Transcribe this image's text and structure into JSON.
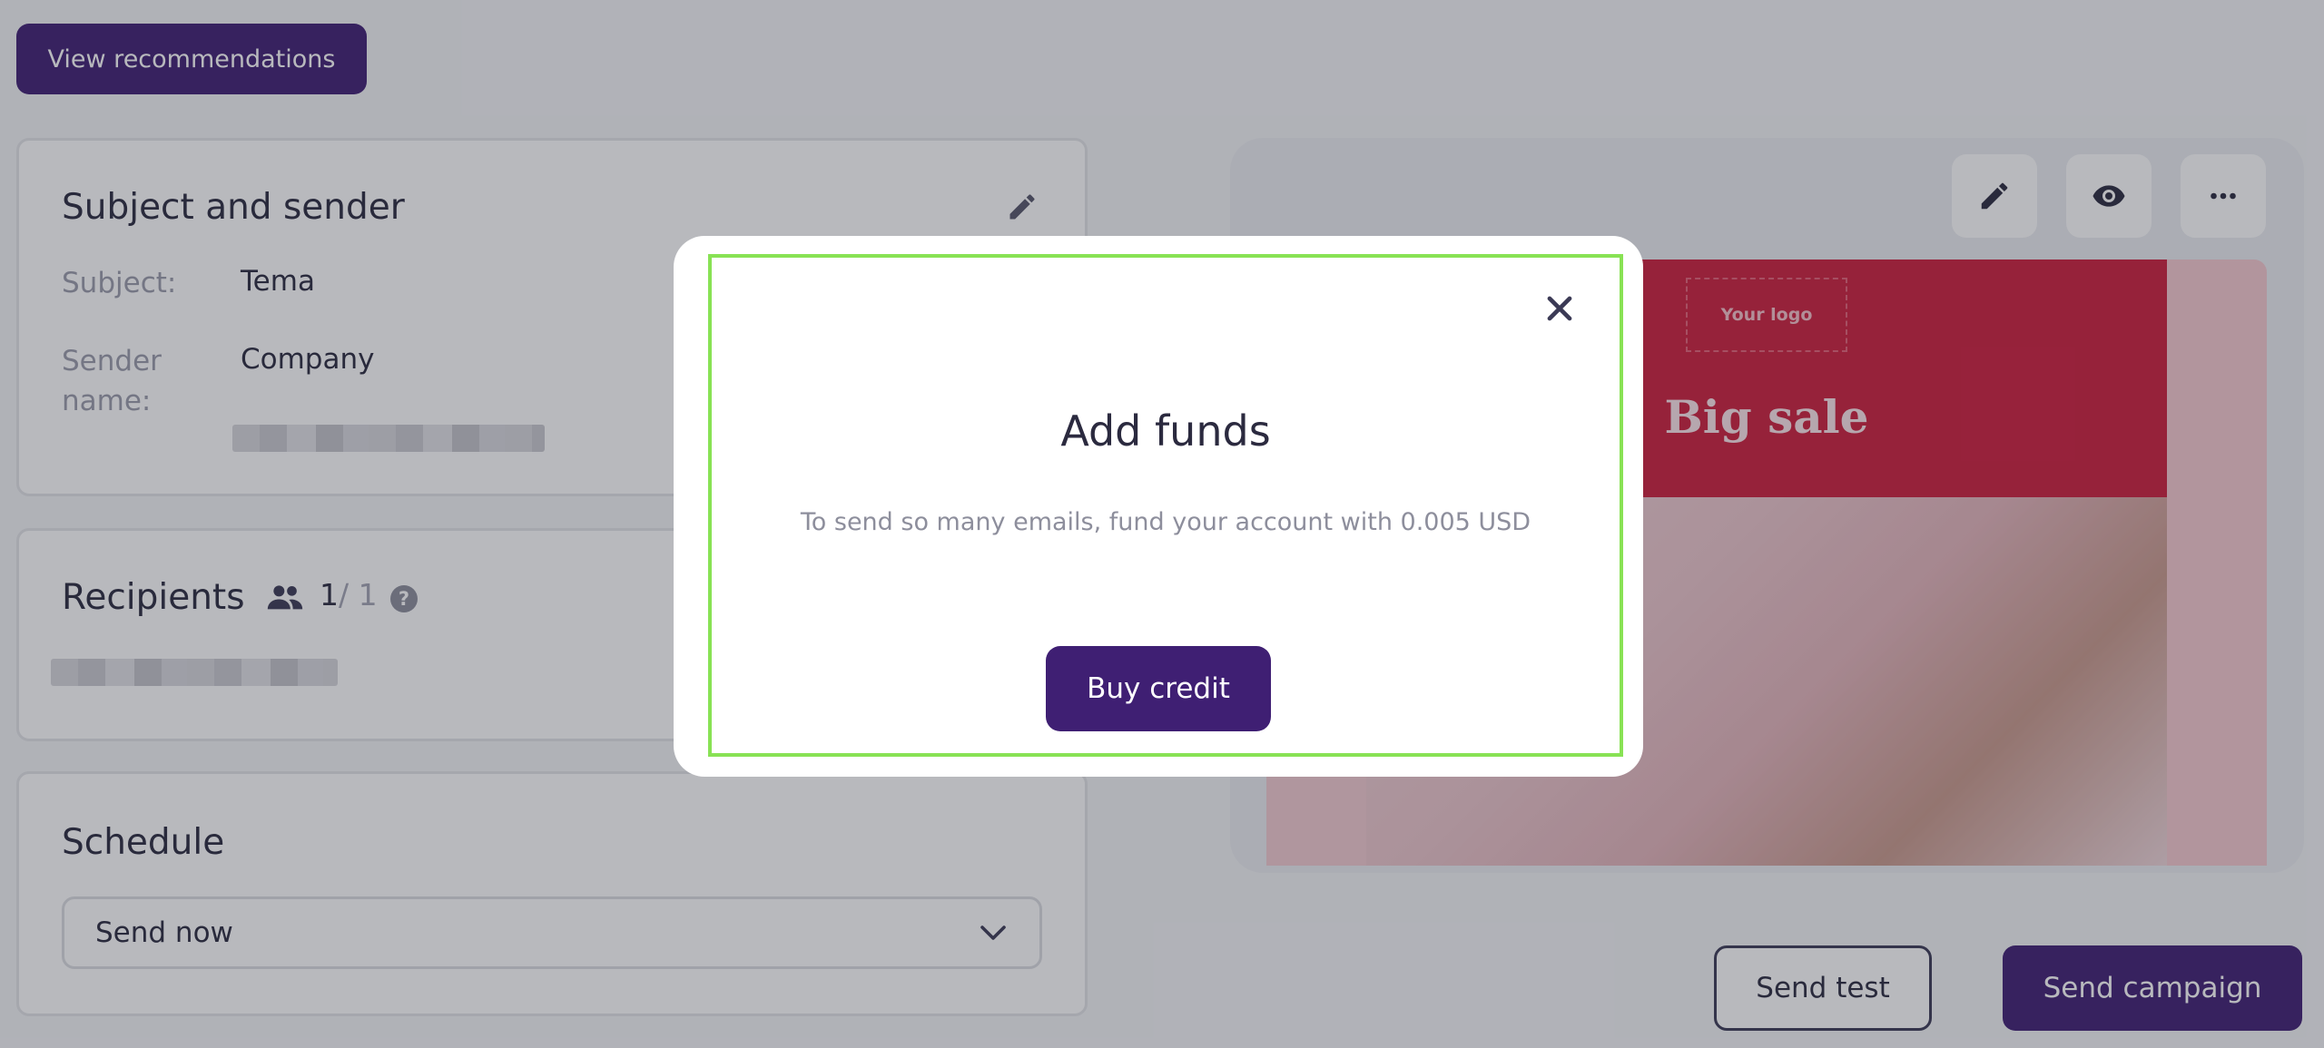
{
  "header": {
    "recommendations_label": "View recommendations"
  },
  "subject_card": {
    "title": "Subject and sender",
    "subject_label": "Subject:",
    "subject_value": "Tema",
    "sender_label_line1": "Sender",
    "sender_label_line2": "name:",
    "sender_value": "Company"
  },
  "recipients_card": {
    "title": "Recipients",
    "count_current": "1",
    "count_total": "/ 1",
    "help": "?"
  },
  "schedule_card": {
    "title": "Schedule",
    "selected_option": "Send now"
  },
  "preview": {
    "logo_text": "Your logo",
    "headline": "Big sale"
  },
  "actions": {
    "send_test_label": "Send test",
    "send_campaign_label": "Send campaign"
  },
  "modal": {
    "title": "Add funds",
    "message": "To send so many emails, fund your account with 0.005 USD",
    "button_label": "Buy credit"
  },
  "colors": {
    "brand": "#3f1f73",
    "email_header": "#cd1e3d",
    "highlight": "#88e254"
  }
}
